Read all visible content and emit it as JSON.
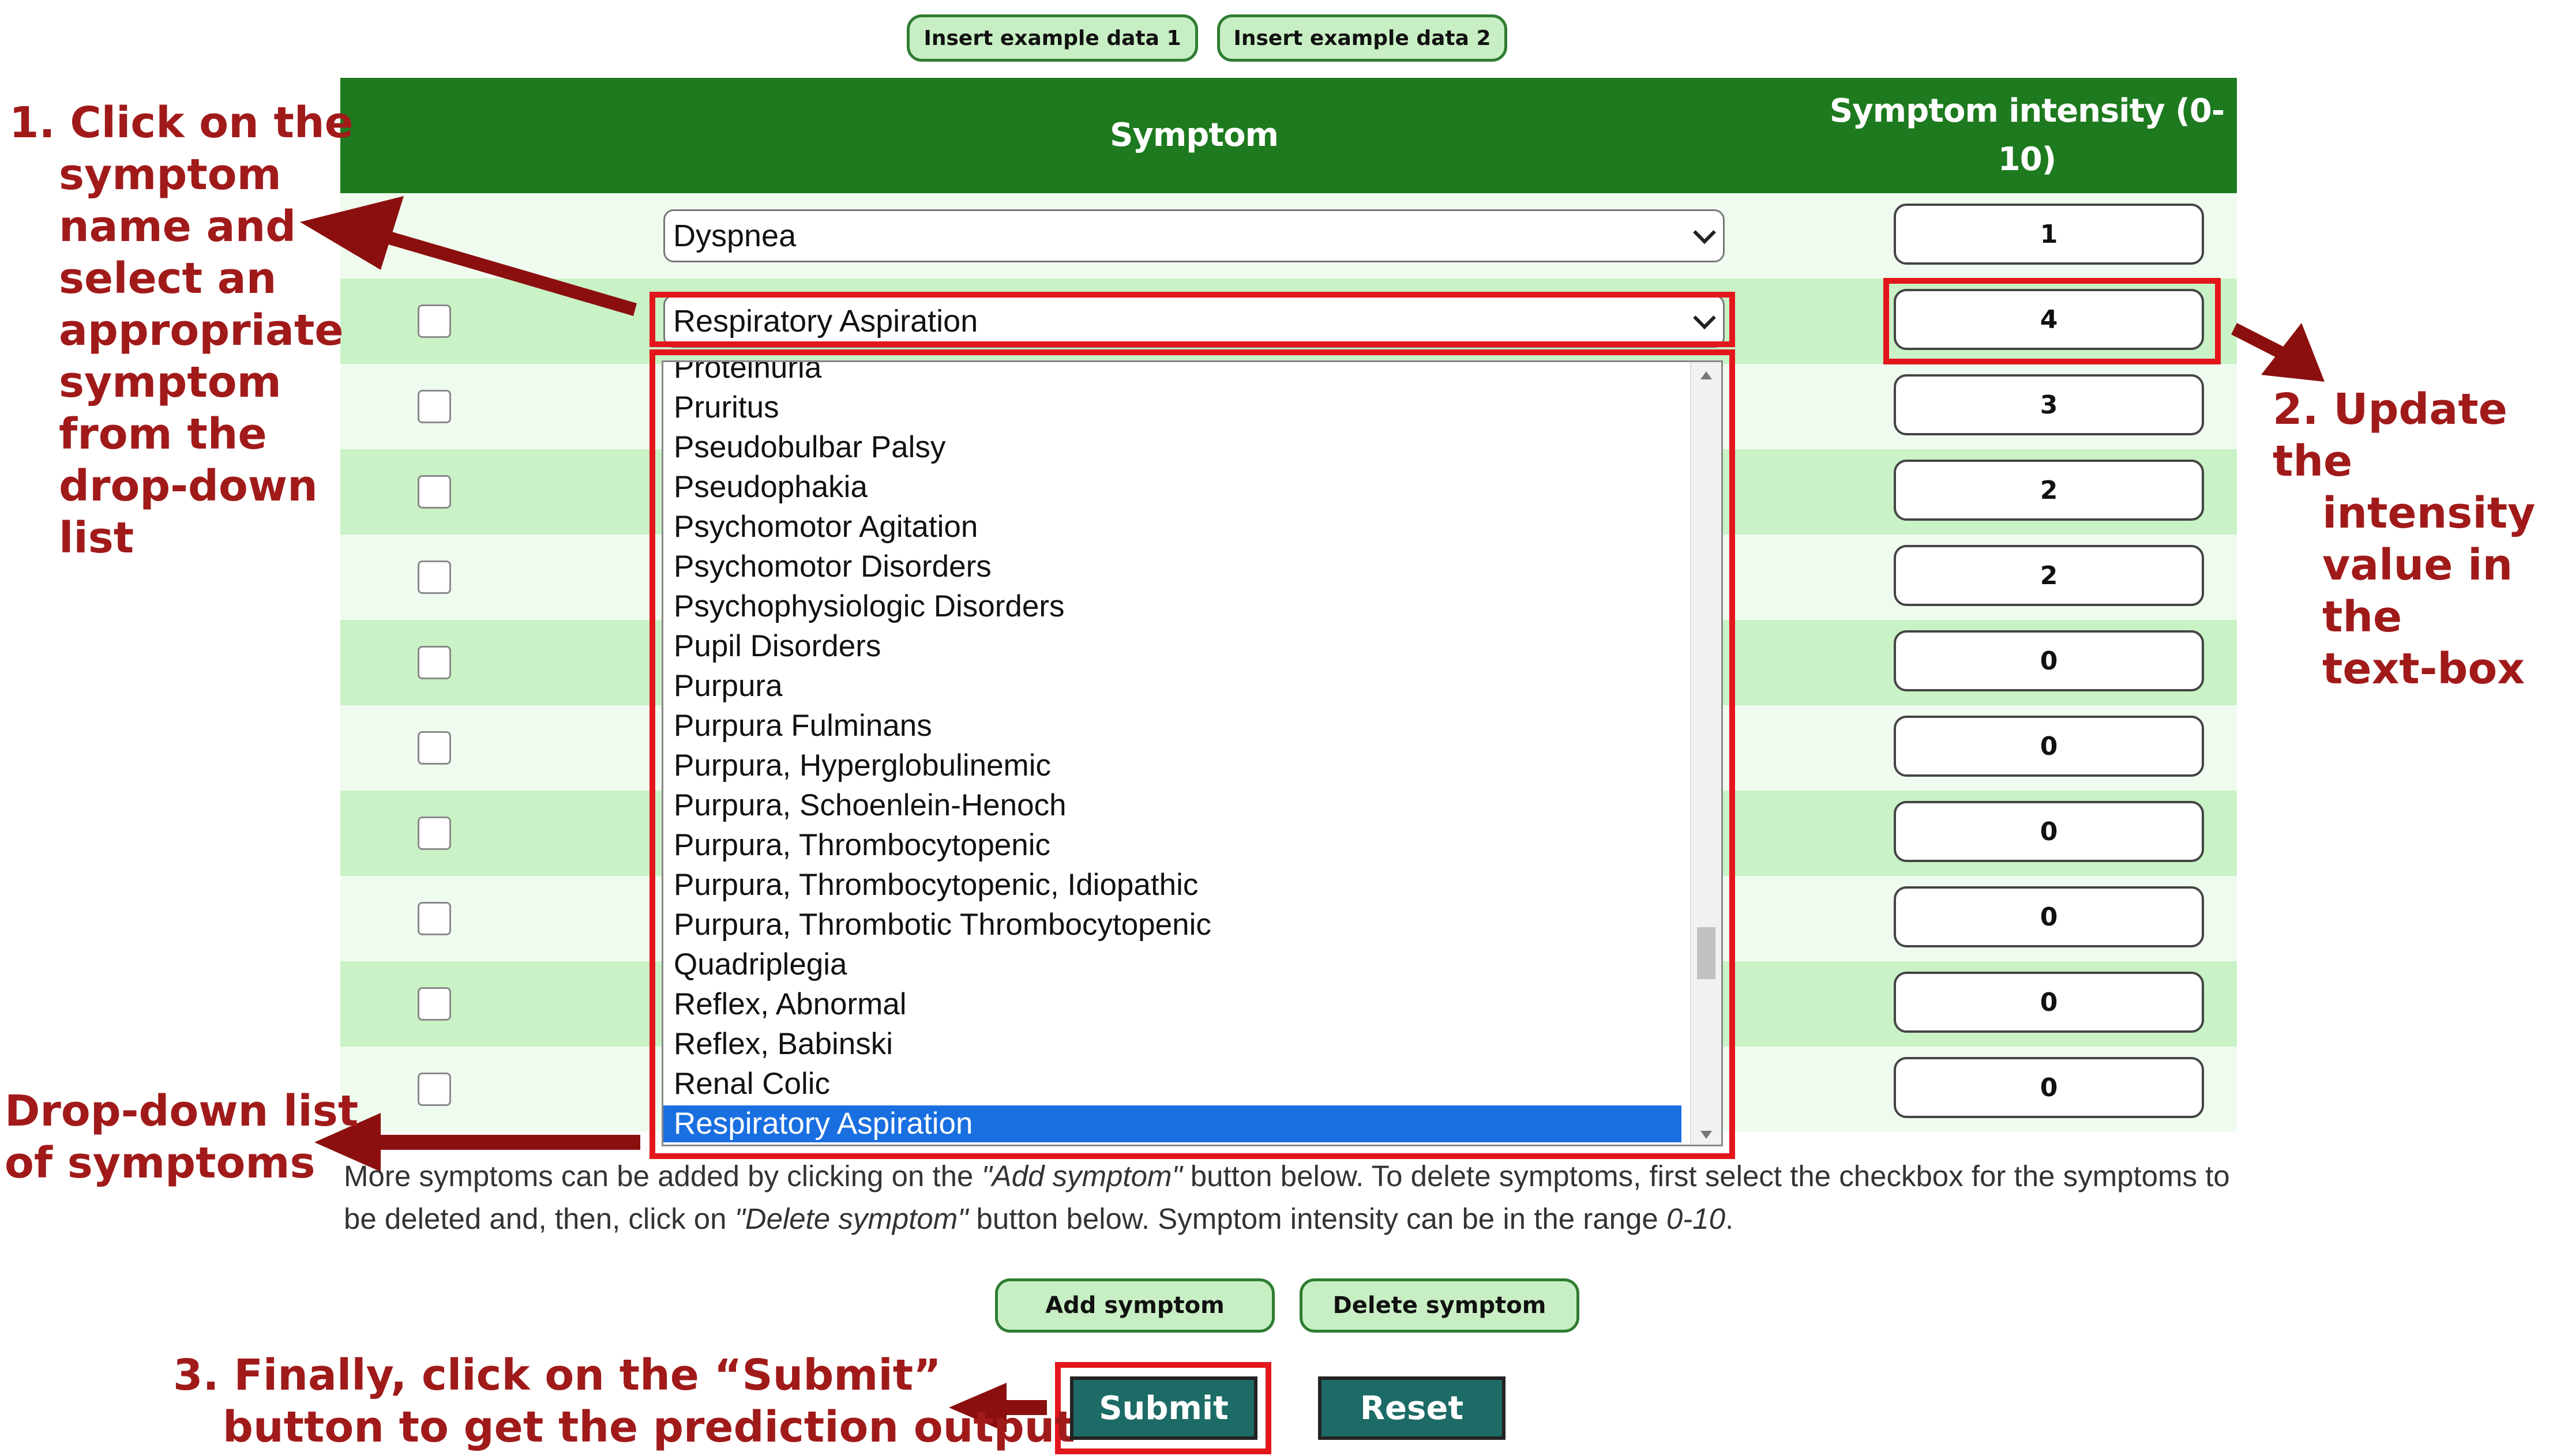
{
  "toolbar": {
    "example1_label": "Insert example data 1",
    "example2_label": "Insert example data 2"
  },
  "table": {
    "col_symptom": "Symptom",
    "col_intensity_line1": "Symptom intensity (0-",
    "col_intensity_line2": "10)",
    "rows": [
      {
        "symptom": "Dyspnea",
        "intensity": "1",
        "has_checkbox": false
      },
      {
        "symptom": "Respiratory Aspiration",
        "intensity": "4",
        "has_checkbox": true
      },
      {
        "intensity": "3",
        "has_checkbox": true
      },
      {
        "intensity": "2",
        "has_checkbox": true
      },
      {
        "intensity": "2",
        "has_checkbox": true
      },
      {
        "intensity": "0",
        "has_checkbox": true
      },
      {
        "intensity": "0",
        "has_checkbox": true
      },
      {
        "intensity": "0",
        "has_checkbox": true
      },
      {
        "intensity": "0",
        "has_checkbox": true
      },
      {
        "intensity": "0",
        "has_checkbox": true
      },
      {
        "intensity": "0",
        "has_checkbox": true
      }
    ]
  },
  "dropdown": {
    "options": [
      "Proteinuria",
      "Pruritus",
      "Pseudobulbar Palsy",
      "Pseudophakia",
      "Psychomotor Agitation",
      "Psychomotor Disorders",
      "Psychophysiologic Disorders",
      "Pupil Disorders",
      "Purpura",
      "Purpura Fulminans",
      "Purpura, Hyperglobulinemic",
      "Purpura, Schoenlein-Henoch",
      "Purpura, Thrombocytopenic",
      "Purpura, Thrombocytopenic, Idiopathic",
      "Purpura, Thrombotic Thrombocytopenic",
      "Quadriplegia",
      "Reflex, Abnormal",
      "Reflex, Babinski",
      "Renal Colic",
      "Respiratory Aspiration"
    ],
    "selected": "Respiratory Aspiration"
  },
  "help": {
    "p1": "More symptoms can be added by clicking on the ",
    "add_ref": "\"Add symptom\"",
    "p2": " button below. To delete symptoms, first select the checkbox for the symptoms to be deleted and, then, click on ",
    "delete_ref": "\"Delete symptom\"",
    "p3": " button below. Symptom intensity can be in the range ",
    "range": "0-10",
    "p4": "."
  },
  "actions": {
    "add_label": "Add symptom",
    "delete_label": "Delete symptom",
    "submit_label": "Submit",
    "reset_label": "Reset"
  },
  "annotations": {
    "step1": [
      "1. Click on the",
      "symptom",
      "name and",
      "select an",
      "appropriate",
      "symptom",
      "from the",
      "drop-down",
      "list"
    ],
    "step2": [
      "2. Update the",
      "intensity",
      "value in the",
      "text-box"
    ],
    "dropdown_note": [
      "Drop-down list",
      "of symptoms"
    ],
    "step3": [
      "3. Finally, click on the “Submit”",
      "button to get the prediction output"
    ]
  },
  "colors": {
    "header_green": "#1e7a1e",
    "annotation_red": "#a11a1a",
    "highlight_red": "#e3161c",
    "selected_blue": "#1a6fe0",
    "button_teal": "#1d6b66"
  }
}
